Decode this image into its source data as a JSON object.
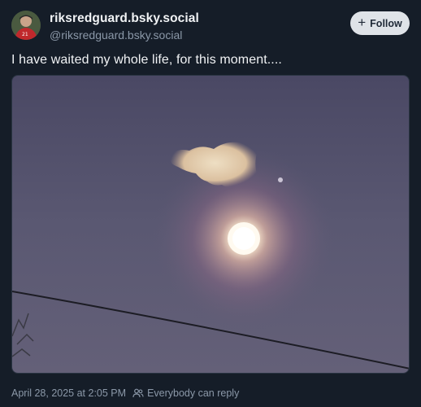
{
  "author": {
    "display_name": "riksredguard.bsky.social",
    "handle": "@riksredguard.bsky.social"
  },
  "follow_button": {
    "label": "Follow",
    "icon": "plus-icon"
  },
  "post": {
    "text": "I have waited my whole life, for this moment....",
    "image_alt_icon": "photo"
  },
  "footer": {
    "timestamp": "April 28, 2025 at 2:05 PM",
    "reply_setting": "Everybody can reply",
    "reply_icon": "people-icon"
  },
  "colors": {
    "background": "#151d28",
    "button_bg": "#dfe3e8",
    "muted_text": "#8b98a8"
  }
}
